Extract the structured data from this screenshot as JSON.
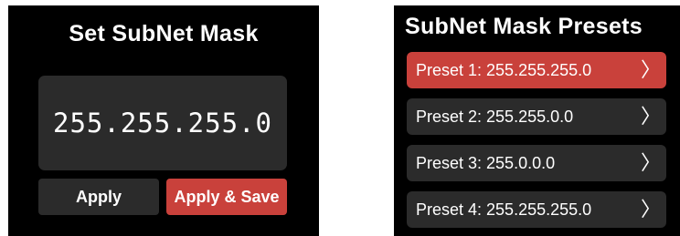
{
  "left_panel": {
    "title": "Set SubNet Mask",
    "value": "255.255.255.0",
    "apply_label": "Apply",
    "apply_save_label": "Apply & Save"
  },
  "right_panel": {
    "title": "SubNet Mask Presets",
    "selected_index": 0,
    "presets": [
      {
        "label": "Preset 1:  255.255.255.0"
      },
      {
        "label": "Preset 2:  255.255.0.0"
      },
      {
        "label": "Preset 3:  255.0.0.0"
      },
      {
        "label": "Preset 4:  255.255.255.0"
      }
    ],
    "chevron_icon": "chevron-right-icon"
  },
  "colors": {
    "background": "#000000",
    "surface": "#2b2b2b",
    "accent": "#c9413b",
    "text": "#ffffff"
  }
}
